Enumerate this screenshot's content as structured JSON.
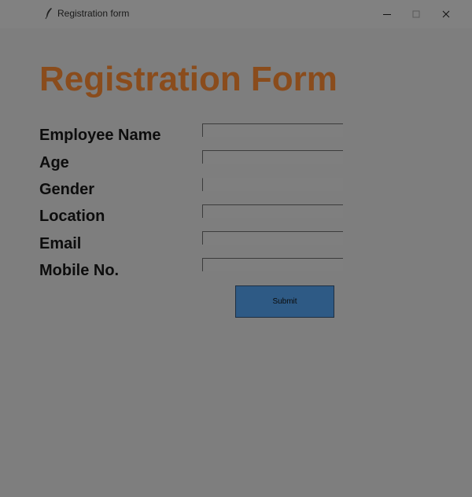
{
  "window": {
    "title": "Registration form",
    "controls": {
      "minimize_icon": "minimize-icon",
      "maximize_icon": "maximize-icon",
      "close_icon": "close-icon"
    }
  },
  "form": {
    "heading": "Registration Form",
    "fields": [
      {
        "label": "Employee Name",
        "value": ""
      },
      {
        "label": "Age",
        "value": ""
      },
      {
        "label": "Gender",
        "value": ""
      },
      {
        "label": "Location",
        "value": ""
      },
      {
        "label": "Email",
        "value": ""
      },
      {
        "label": "Mobile No.",
        "value": ""
      }
    ],
    "submit_label": "Submit"
  },
  "colors": {
    "heading": "#8a4c1c",
    "submit_button": "#2e5a85",
    "background": "#7f7f7f"
  }
}
